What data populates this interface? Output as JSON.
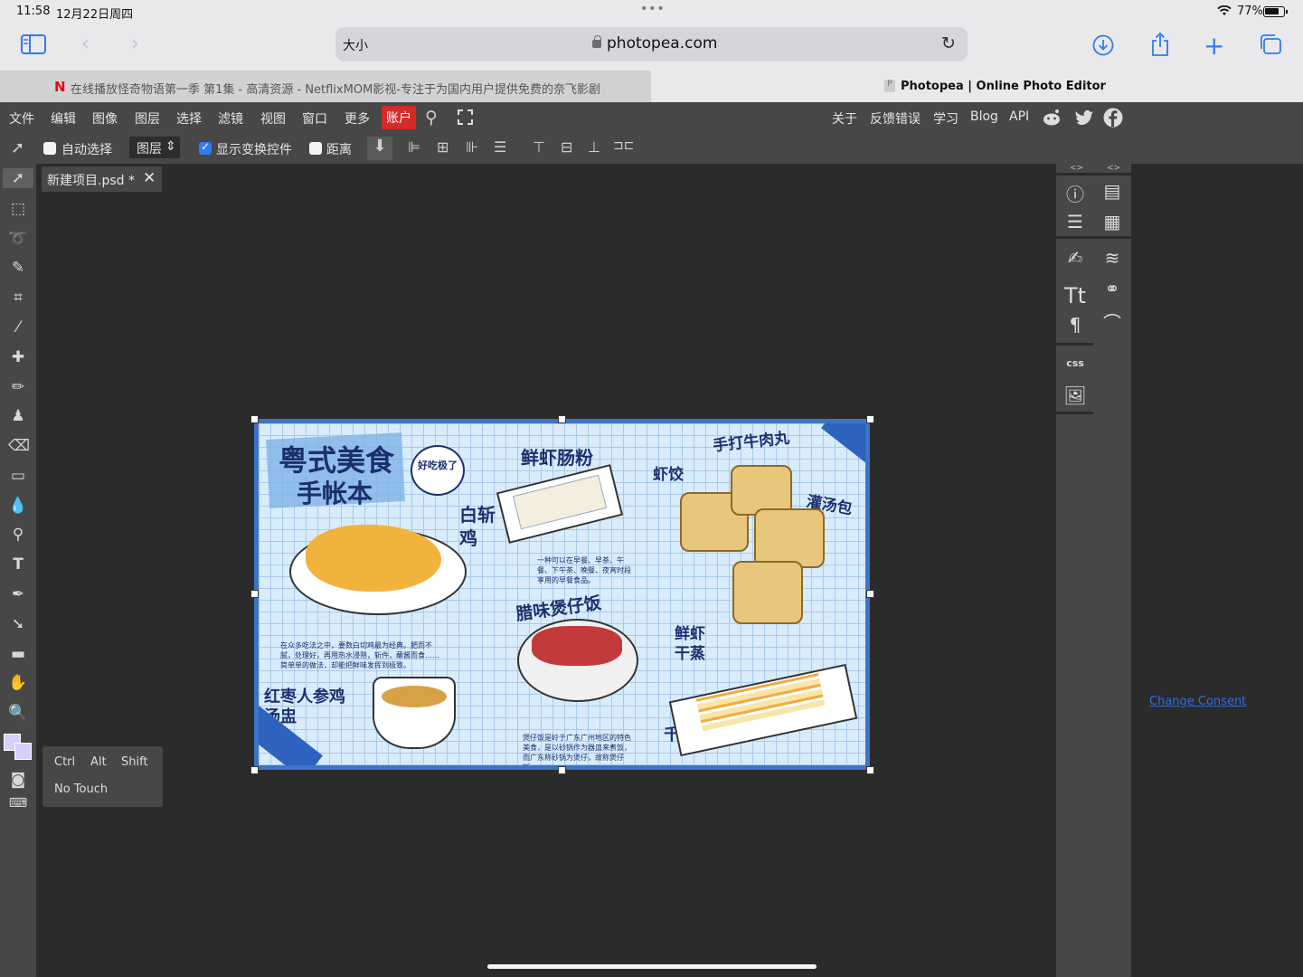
{
  "status_bar": {
    "time": "11:58",
    "date": "12月22日周四",
    "battery": "77%"
  },
  "browser": {
    "address_size_label": "大小",
    "url": "photopea.com",
    "tabs": [
      {
        "title": "在线播放怪奇物语第一季 第1集 - 高清资源 - NetflixMOM影视-专注于为国内用户提供免费的奈飞影剧",
        "favicon": "N"
      },
      {
        "title": "Photopea | Online Photo Editor",
        "favicon": "P"
      }
    ]
  },
  "menu": {
    "items": [
      "文件",
      "编辑",
      "图像",
      "图层",
      "选择",
      "滤镜",
      "视图",
      "窗口",
      "更多",
      "账户"
    ],
    "right": [
      "关于",
      "反馈错误",
      "学习",
      "Blog",
      "API"
    ]
  },
  "options": {
    "auto_select": "自动选择",
    "layer_select": "图层",
    "show_transform": "显示变换控件",
    "distance": "距离"
  },
  "document": {
    "tab_name": "新建项目.psd *"
  },
  "artwork": {
    "title_line1": "粤式美食",
    "title_line2": "手帐本",
    "bubble": "好吃极了",
    "dish1": "鲜虾肠粉",
    "dish2": "白斩鸡",
    "dish3": "虾饺",
    "dish4": "手打牛肉丸",
    "dish5": "灌汤包",
    "dish6": "腊味煲仔饭",
    "dish7": "鲜虾干蒸",
    "dish8": "红枣人参鸡汤盅",
    "dish9": "千层糕",
    "note1": "一种可以在早餐、早茶、午餐、下午茶、晚餐、夜宵时段享用的早餐食品。",
    "note2": "在众多吃法之中，要数白切鸡最为经典。肥而不腻，处理好，再用热水浸熟，斩件，蘸酱而食……简单单的做法，却能把鲜味发挥到极致。",
    "note3": "煲仔饭是岭于广东广州地区的特色美食，是以砂锅作为器皿来煮饭，而广东称砂锅为煲仔，故称煲仔饭。"
  },
  "right_panel": {
    "css_label": "css"
  },
  "consent_link": "Change Consent",
  "modifier_popup": {
    "keys": [
      "Ctrl",
      "Alt",
      "Shift"
    ],
    "no_touch": "No Touch"
  },
  "colors": {
    "accent": "#2f7bf5",
    "account_button": "#d42a2a",
    "panel_bg": "#474747",
    "workspace_bg": "#2b2b2b",
    "foreground_color": "#d9cfff"
  }
}
